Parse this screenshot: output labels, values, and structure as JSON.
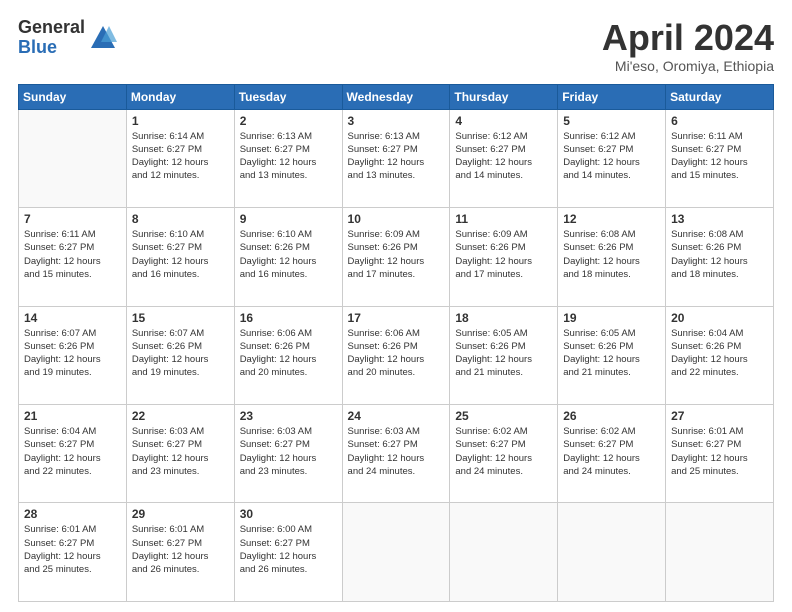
{
  "logo": {
    "general": "General",
    "blue": "Blue"
  },
  "title": "April 2024",
  "subtitle": "Mi'eso, Oromiya, Ethiopia",
  "days_header": [
    "Sunday",
    "Monday",
    "Tuesday",
    "Wednesday",
    "Thursday",
    "Friday",
    "Saturday"
  ],
  "weeks": [
    [
      {
        "day": "",
        "sunrise": "",
        "sunset": "",
        "daylight": ""
      },
      {
        "day": "1",
        "sunrise": "Sunrise: 6:14 AM",
        "sunset": "Sunset: 6:27 PM",
        "daylight": "Daylight: 12 hours and 12 minutes."
      },
      {
        "day": "2",
        "sunrise": "Sunrise: 6:13 AM",
        "sunset": "Sunset: 6:27 PM",
        "daylight": "Daylight: 12 hours and 13 minutes."
      },
      {
        "day": "3",
        "sunrise": "Sunrise: 6:13 AM",
        "sunset": "Sunset: 6:27 PM",
        "daylight": "Daylight: 12 hours and 13 minutes."
      },
      {
        "day": "4",
        "sunrise": "Sunrise: 6:12 AM",
        "sunset": "Sunset: 6:27 PM",
        "daylight": "Daylight: 12 hours and 14 minutes."
      },
      {
        "day": "5",
        "sunrise": "Sunrise: 6:12 AM",
        "sunset": "Sunset: 6:27 PM",
        "daylight": "Daylight: 12 hours and 14 minutes."
      },
      {
        "day": "6",
        "sunrise": "Sunrise: 6:11 AM",
        "sunset": "Sunset: 6:27 PM",
        "daylight": "Daylight: 12 hours and 15 minutes."
      }
    ],
    [
      {
        "day": "7",
        "sunrise": "Sunrise: 6:11 AM",
        "sunset": "Sunset: 6:27 PM",
        "daylight": "Daylight: 12 hours and 15 minutes."
      },
      {
        "day": "8",
        "sunrise": "Sunrise: 6:10 AM",
        "sunset": "Sunset: 6:27 PM",
        "daylight": "Daylight: 12 hours and 16 minutes."
      },
      {
        "day": "9",
        "sunrise": "Sunrise: 6:10 AM",
        "sunset": "Sunset: 6:26 PM",
        "daylight": "Daylight: 12 hours and 16 minutes."
      },
      {
        "day": "10",
        "sunrise": "Sunrise: 6:09 AM",
        "sunset": "Sunset: 6:26 PM",
        "daylight": "Daylight: 12 hours and 17 minutes."
      },
      {
        "day": "11",
        "sunrise": "Sunrise: 6:09 AM",
        "sunset": "Sunset: 6:26 PM",
        "daylight": "Daylight: 12 hours and 17 minutes."
      },
      {
        "day": "12",
        "sunrise": "Sunrise: 6:08 AM",
        "sunset": "Sunset: 6:26 PM",
        "daylight": "Daylight: 12 hours and 18 minutes."
      },
      {
        "day": "13",
        "sunrise": "Sunrise: 6:08 AM",
        "sunset": "Sunset: 6:26 PM",
        "daylight": "Daylight: 12 hours and 18 minutes."
      }
    ],
    [
      {
        "day": "14",
        "sunrise": "Sunrise: 6:07 AM",
        "sunset": "Sunset: 6:26 PM",
        "daylight": "Daylight: 12 hours and 19 minutes."
      },
      {
        "day": "15",
        "sunrise": "Sunrise: 6:07 AM",
        "sunset": "Sunset: 6:26 PM",
        "daylight": "Daylight: 12 hours and 19 minutes."
      },
      {
        "day": "16",
        "sunrise": "Sunrise: 6:06 AM",
        "sunset": "Sunset: 6:26 PM",
        "daylight": "Daylight: 12 hours and 20 minutes."
      },
      {
        "day": "17",
        "sunrise": "Sunrise: 6:06 AM",
        "sunset": "Sunset: 6:26 PM",
        "daylight": "Daylight: 12 hours and 20 minutes."
      },
      {
        "day": "18",
        "sunrise": "Sunrise: 6:05 AM",
        "sunset": "Sunset: 6:26 PM",
        "daylight": "Daylight: 12 hours and 21 minutes."
      },
      {
        "day": "19",
        "sunrise": "Sunrise: 6:05 AM",
        "sunset": "Sunset: 6:26 PM",
        "daylight": "Daylight: 12 hours and 21 minutes."
      },
      {
        "day": "20",
        "sunrise": "Sunrise: 6:04 AM",
        "sunset": "Sunset: 6:26 PM",
        "daylight": "Daylight: 12 hours and 22 minutes."
      }
    ],
    [
      {
        "day": "21",
        "sunrise": "Sunrise: 6:04 AM",
        "sunset": "Sunset: 6:27 PM",
        "daylight": "Daylight: 12 hours and 22 minutes."
      },
      {
        "day": "22",
        "sunrise": "Sunrise: 6:03 AM",
        "sunset": "Sunset: 6:27 PM",
        "daylight": "Daylight: 12 hours and 23 minutes."
      },
      {
        "day": "23",
        "sunrise": "Sunrise: 6:03 AM",
        "sunset": "Sunset: 6:27 PM",
        "daylight": "Daylight: 12 hours and 23 minutes."
      },
      {
        "day": "24",
        "sunrise": "Sunrise: 6:03 AM",
        "sunset": "Sunset: 6:27 PM",
        "daylight": "Daylight: 12 hours and 24 minutes."
      },
      {
        "day": "25",
        "sunrise": "Sunrise: 6:02 AM",
        "sunset": "Sunset: 6:27 PM",
        "daylight": "Daylight: 12 hours and 24 minutes."
      },
      {
        "day": "26",
        "sunrise": "Sunrise: 6:02 AM",
        "sunset": "Sunset: 6:27 PM",
        "daylight": "Daylight: 12 hours and 24 minutes."
      },
      {
        "day": "27",
        "sunrise": "Sunrise: 6:01 AM",
        "sunset": "Sunset: 6:27 PM",
        "daylight": "Daylight: 12 hours and 25 minutes."
      }
    ],
    [
      {
        "day": "28",
        "sunrise": "Sunrise: 6:01 AM",
        "sunset": "Sunset: 6:27 PM",
        "daylight": "Daylight: 12 hours and 25 minutes."
      },
      {
        "day": "29",
        "sunrise": "Sunrise: 6:01 AM",
        "sunset": "Sunset: 6:27 PM",
        "daylight": "Daylight: 12 hours and 26 minutes."
      },
      {
        "day": "30",
        "sunrise": "Sunrise: 6:00 AM",
        "sunset": "Sunset: 6:27 PM",
        "daylight": "Daylight: 12 hours and 26 minutes."
      },
      {
        "day": "",
        "sunrise": "",
        "sunset": "",
        "daylight": ""
      },
      {
        "day": "",
        "sunrise": "",
        "sunset": "",
        "daylight": ""
      },
      {
        "day": "",
        "sunrise": "",
        "sunset": "",
        "daylight": ""
      },
      {
        "day": "",
        "sunrise": "",
        "sunset": "",
        "daylight": ""
      }
    ]
  ]
}
